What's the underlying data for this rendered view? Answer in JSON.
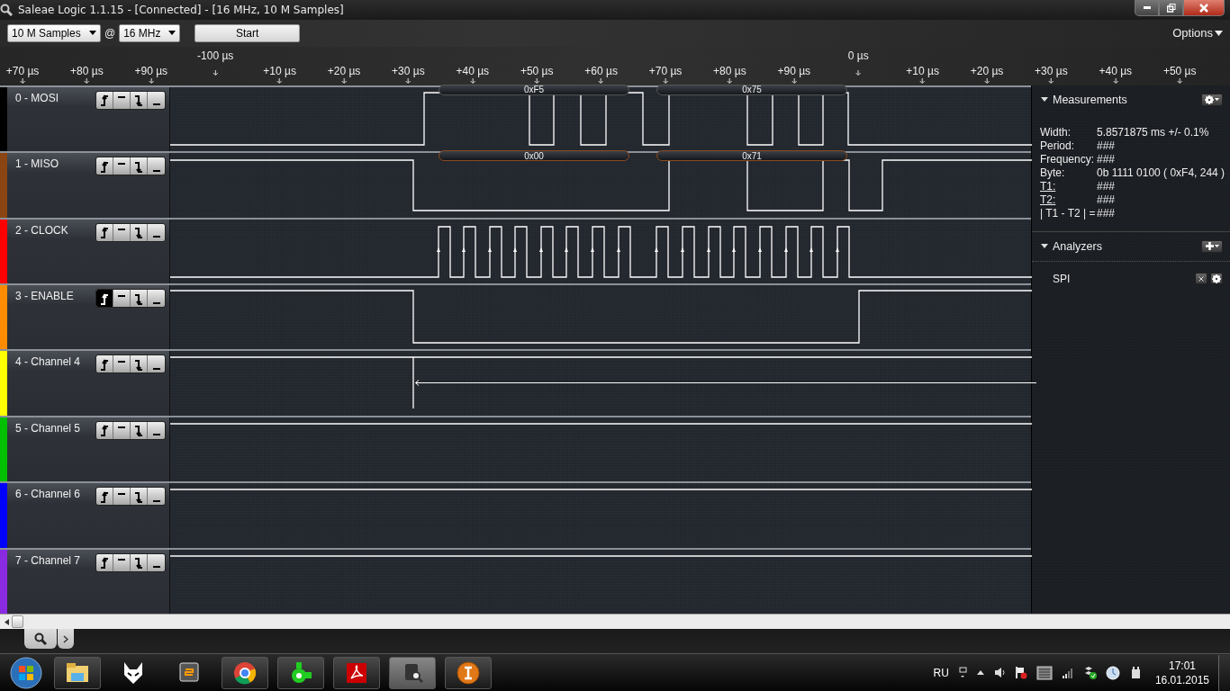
{
  "window": {
    "title": "Saleae Logic 1.1.15 - [Connected] - [16 MHz, 10 M Samples]"
  },
  "toolbar": {
    "samples": "10 M Samples",
    "at": "@",
    "rate": "16 MHz",
    "start": "Start",
    "options": "Options"
  },
  "ruler": {
    "labels": [
      {
        "text": "+70 µs",
        "kind": "minor"
      },
      {
        "text": "+80 µs",
        "kind": "minor"
      },
      {
        "text": "+90 µs",
        "kind": "minor"
      },
      {
        "text": "-100 µs",
        "kind": "major"
      },
      {
        "text": "+10 µs",
        "kind": "minor"
      },
      {
        "text": "+20 µs",
        "kind": "minor"
      },
      {
        "text": "+30 µs",
        "kind": "minor"
      },
      {
        "text": "+40 µs",
        "kind": "minor"
      },
      {
        "text": "+50 µs",
        "kind": "minor"
      },
      {
        "text": "+60 µs",
        "kind": "minor"
      },
      {
        "text": "+70 µs",
        "kind": "minor"
      },
      {
        "text": "+80 µs",
        "kind": "minor"
      },
      {
        "text": "+90 µs",
        "kind": "minor"
      },
      {
        "text": "0 µs",
        "kind": "major"
      },
      {
        "text": "+10 µs",
        "kind": "minor"
      },
      {
        "text": "+20 µs",
        "kind": "minor"
      },
      {
        "text": "+30 µs",
        "kind": "minor"
      },
      {
        "text": "+40 µs",
        "kind": "minor"
      },
      {
        "text": "+50 µs",
        "kind": "minor"
      }
    ]
  },
  "channels": [
    {
      "name": "0 - MOSI",
      "color": "#000000",
      "rising_trigger": false,
      "decoded": [
        "0xF5",
        "0x75"
      ]
    },
    {
      "name": "1 - MISO",
      "color": "#8b4513",
      "rising_trigger": false,
      "decoded": [
        "0x00",
        "0x71"
      ]
    },
    {
      "name": "2 - CLOCK",
      "color": "#ff0000",
      "rising_trigger": false
    },
    {
      "name": "3 - ENABLE",
      "color": "#ff8c00",
      "rising_trigger": true
    },
    {
      "name": "4 - Channel 4",
      "color": "#ffff00",
      "rising_trigger": false
    },
    {
      "name": "5 - Channel 5",
      "color": "#00c000",
      "rising_trigger": false
    },
    {
      "name": "6 - Channel 6",
      "color": "#0000ff",
      "rising_trigger": false
    },
    {
      "name": "7 - Channel 7",
      "color": "#8a2be2",
      "rising_trigger": false
    }
  ],
  "measurements": {
    "title": "Measurements",
    "rows": [
      {
        "label": "Width:",
        "value": "5.8571875 ms +/- 0.1%",
        "kind": "plain"
      },
      {
        "label": "Period:",
        "value": "###",
        "kind": "plain"
      },
      {
        "label": "Frequency:",
        "value": "###",
        "kind": "plain"
      },
      {
        "label": "Byte:",
        "value": "0b  1111  0100 ( 0xF4, 244 )",
        "kind": "plain"
      },
      {
        "label": "T1:",
        "value": "###",
        "kind": "link"
      },
      {
        "label": "T2:",
        "value": "###",
        "kind": "link"
      },
      {
        "label": "| T1 - T2 | =",
        "value": "###",
        "kind": "plain"
      }
    ]
  },
  "analyzers": {
    "title": "Analyzers",
    "items": [
      "SPI"
    ]
  },
  "taskbar": {
    "language": "RU",
    "time": "17:01",
    "date": "16.01.2015"
  }
}
